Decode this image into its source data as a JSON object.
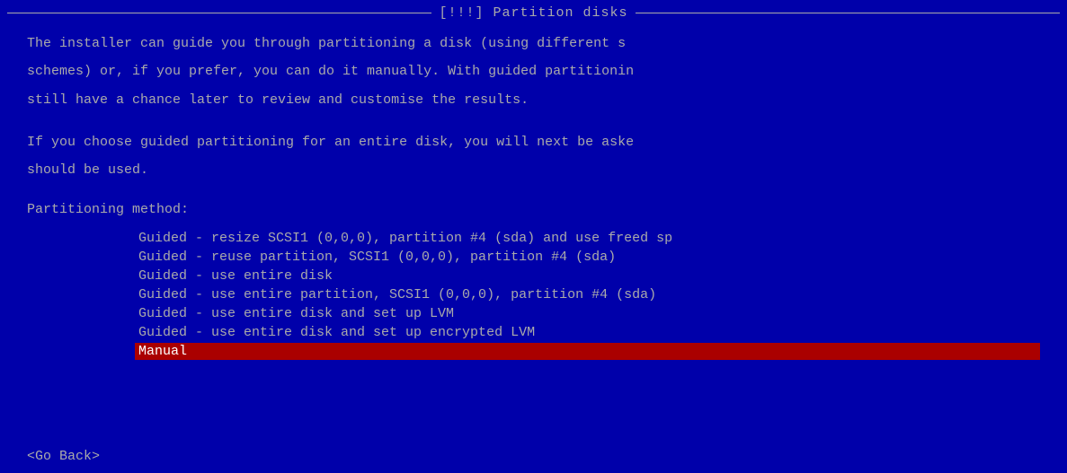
{
  "title": "[!!!] Partition disks",
  "description": {
    "para1": "The installer can guide you through partitioning a disk (using different s",
    "para1b": "schemes) or, if you prefer, you can do it manually. With guided partitionin",
    "para1c": "still have a chance later to review and customise the results.",
    "para2": "If you choose guided partitioning for an entire disk, you will next be aske",
    "para2b": "should be used."
  },
  "partitioning_method_label": "Partitioning method:",
  "options": [
    {
      "text": "Guided - resize SCSI1 (0,0,0), partition #4 (sda) and use freed sp",
      "selected": false
    },
    {
      "text": "Guided - reuse partition, SCSI1 (0,0,0), partition #4 (sda)",
      "selected": false
    },
    {
      "text": "Guided - use entire disk",
      "selected": false
    },
    {
      "text": "Guided - use entire partition, SCSI1 (0,0,0), partition #4 (sda)",
      "selected": false
    },
    {
      "text": "Guided - use entire disk and set up LVM",
      "selected": false
    },
    {
      "text": "Guided - use entire disk and set up encrypted LVM",
      "selected": false
    },
    {
      "text": "Manual",
      "selected": true
    }
  ],
  "go_back_label": "<Go Back>"
}
